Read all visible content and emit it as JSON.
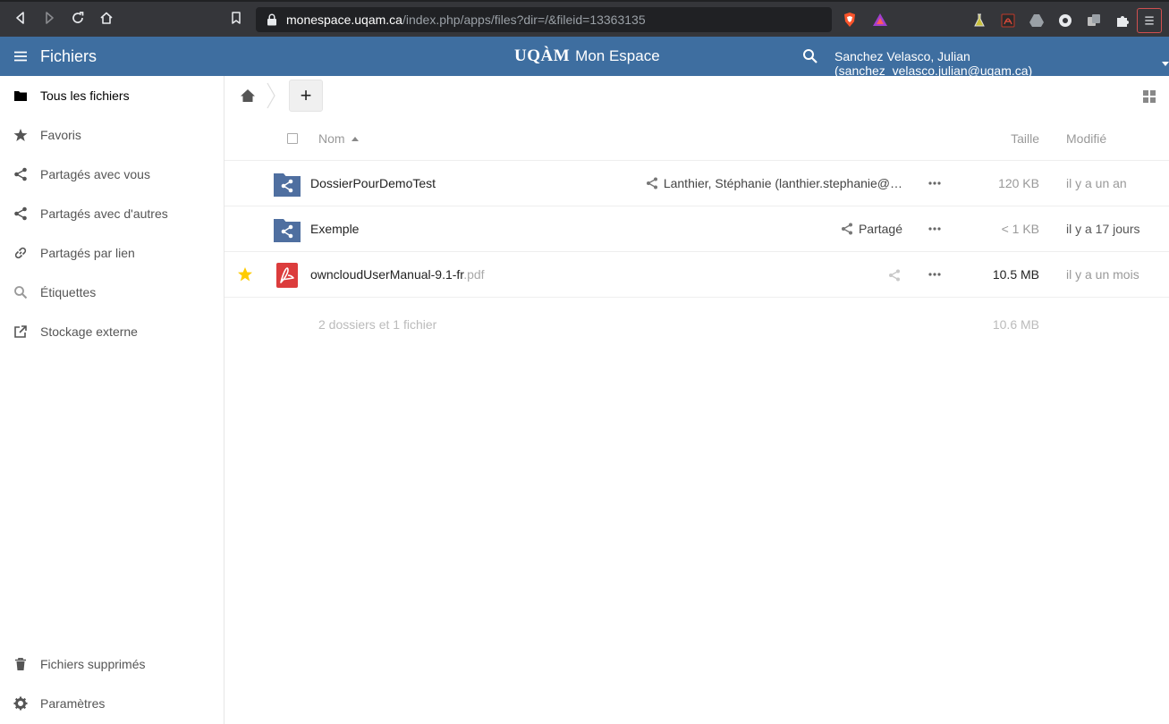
{
  "browser": {
    "url_host": "monespace.uqam.ca",
    "url_path": "/index.php/apps/files?dir=/&fileid=13363135"
  },
  "header": {
    "app_title": "Fichiers",
    "brand_logo": "UQÀM",
    "brand_name": "Mon Espace",
    "user": "Sanchez Velasco, Julian (sanchez_velasco.julian@uqam.ca)",
    "accent_color": "#3e6ea0"
  },
  "sidebar": {
    "items": [
      {
        "label": "Tous les fichiers",
        "icon": "folder-icon"
      },
      {
        "label": "Favoris",
        "icon": "star-icon"
      },
      {
        "label": "Partagés avec vous",
        "icon": "share-icon"
      },
      {
        "label": "Partagés avec d'autres",
        "icon": "share-icon"
      },
      {
        "label": "Partagés par lien",
        "icon": "link-icon"
      },
      {
        "label": "Étiquettes",
        "icon": "search-icon"
      },
      {
        "label": "Stockage externe",
        "icon": "external-link-icon"
      }
    ],
    "bottom": [
      {
        "label": "Fichiers supprimés",
        "icon": "trash-icon"
      },
      {
        "label": "Paramètres",
        "icon": "gear-icon"
      }
    ]
  },
  "controls": {
    "new_label": "+"
  },
  "list": {
    "columns": {
      "name": "Nom",
      "size": "Taille",
      "modified": "Modifié"
    },
    "files": [
      {
        "name": "DossierPourDemoTest",
        "ext": "",
        "type": "shared-folder",
        "favorite": false,
        "share": "Lanthier, Stéphanie (lanthier.stephanie@…",
        "size": "120 KB",
        "modified": "il y a un an"
      },
      {
        "name": "Exemple",
        "ext": "",
        "type": "shared-folder",
        "favorite": false,
        "share": "Partagé",
        "size": "< 1 KB",
        "modified": "il y a 17 jours"
      },
      {
        "name": "owncloudUserManual-9.1-fr",
        "ext": ".pdf",
        "type": "pdf",
        "favorite": true,
        "share": "",
        "size": "10.5 MB",
        "modified": "il y a un mois"
      }
    ],
    "summary": {
      "text": "2 dossiers et 1 fichier",
      "size": "10.6 MB"
    }
  }
}
